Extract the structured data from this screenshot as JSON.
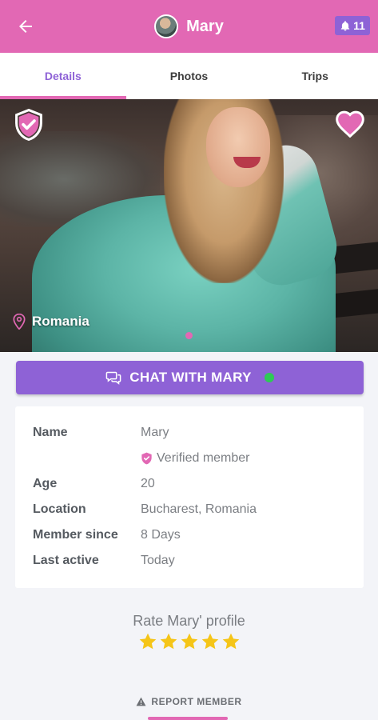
{
  "header": {
    "title": "Mary",
    "notification_count": "11",
    "background_color": "#e268b4",
    "back_icon": "arrow-left-icon",
    "bell_icon": "bell-icon"
  },
  "tabs": [
    {
      "label": "Details",
      "active": true
    },
    {
      "label": "Photos",
      "active": false
    },
    {
      "label": "Trips",
      "active": false
    }
  ],
  "photo": {
    "location": "Romania",
    "verified_icon": "shield-check-icon",
    "like_icon": "heart-icon",
    "pin_icon": "map-pin-icon"
  },
  "chat_button": {
    "label": "CHAT WITH MARY",
    "icon": "chat-bubbles-icon",
    "online": true,
    "color": "#8e62d6"
  },
  "details": {
    "name_label": "Name",
    "name_value": "Mary",
    "verified_text": "Verified member",
    "age_label": "Age",
    "age_value": "20",
    "location_label": "Location",
    "location_value": "Bucharest, Romania",
    "member_since_label": "Member since",
    "member_since_value": "8 Days",
    "last_active_label": "Last active",
    "last_active_value": "Today"
  },
  "rating": {
    "title": "Rate Mary' profile",
    "stars": 5,
    "star_color": "#f5c518"
  },
  "report": {
    "label": "REPORT MEMBER",
    "icon": "warning-icon"
  }
}
